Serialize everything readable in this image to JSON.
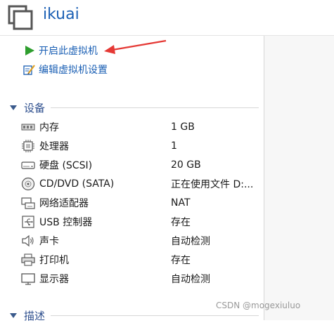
{
  "header": {
    "title": "ikuai",
    "logo_icon": "vm-window-icon"
  },
  "actions": [
    {
      "label": "开启此虚拟机",
      "icon": "play-icon"
    },
    {
      "label": "编辑虚拟机设置",
      "icon": "edit-settings-icon"
    }
  ],
  "devices_section": {
    "title": "设备",
    "icon": "collapse-triangle-icon"
  },
  "devices": [
    {
      "name": "内存",
      "value": "1 GB",
      "icon": "memory-icon"
    },
    {
      "name": "处理器",
      "value": "1",
      "icon": "processor-icon"
    },
    {
      "name": "硬盘 (SCSI)",
      "value": "20 GB",
      "icon": "hard-disk-icon"
    },
    {
      "name": "CD/DVD (SATA)",
      "value": "正在使用文件 D:...",
      "icon": "cd-dvd-icon"
    },
    {
      "name": "网络适配器",
      "value": "NAT",
      "icon": "network-adapter-icon"
    },
    {
      "name": "USB 控制器",
      "value": "存在",
      "icon": "usb-icon"
    },
    {
      "name": "声卡",
      "value": "自动检测",
      "icon": "sound-card-icon"
    },
    {
      "name": "打印机",
      "value": "存在",
      "icon": "printer-icon"
    },
    {
      "name": "显示器",
      "value": "自动检测",
      "icon": "display-icon"
    }
  ],
  "description_section": {
    "title": "描述",
    "icon": "collapse-triangle-icon"
  },
  "watermark": "CSDN @mogexiuluo",
  "colors": {
    "accent": "#1a5fb4",
    "play": "#2e9e2e",
    "arrow": "#e53935",
    "section": "#2e4f8e"
  }
}
